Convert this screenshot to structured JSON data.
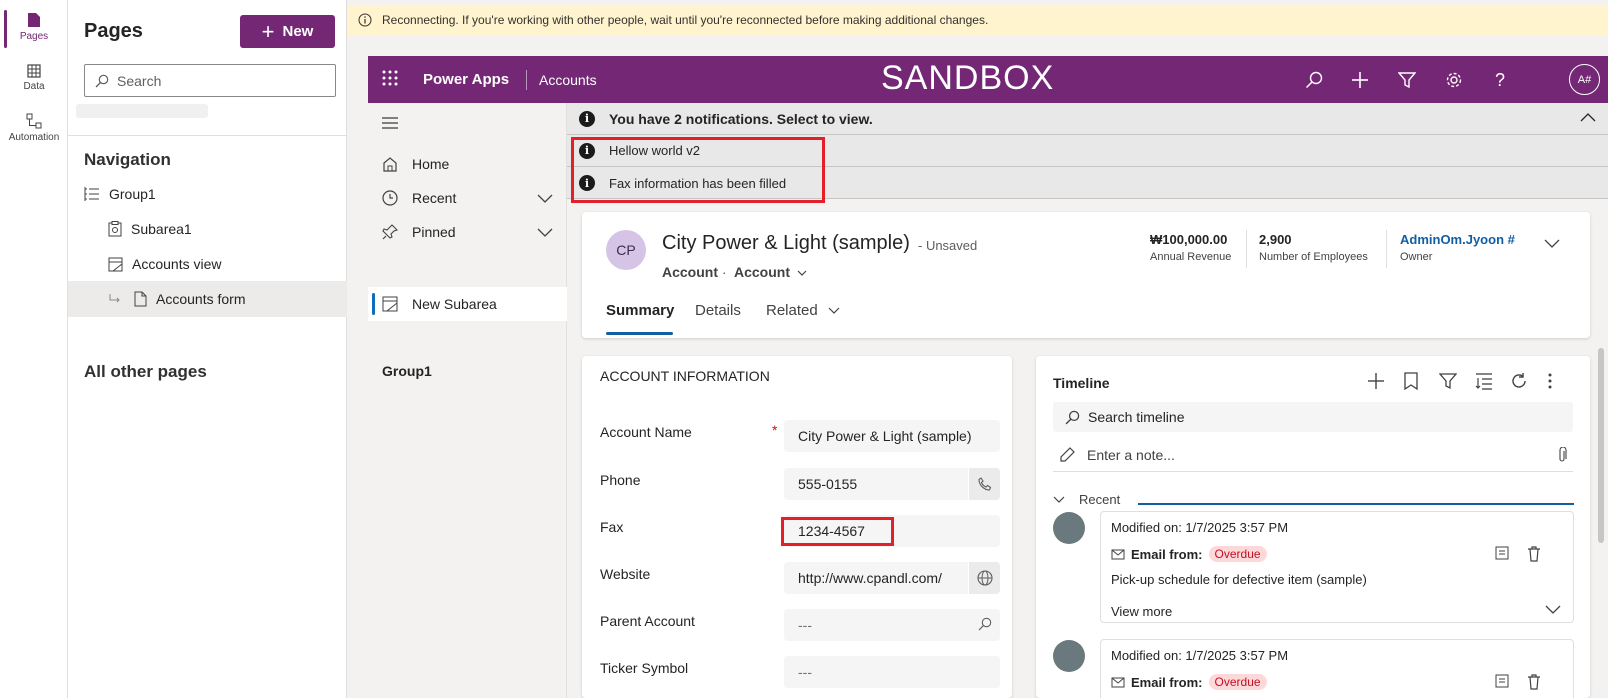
{
  "rail": {
    "items": [
      {
        "label": "Pages",
        "icon": "page-icon"
      },
      {
        "label": "Data",
        "icon": "table-icon"
      },
      {
        "label": "Automation",
        "icon": "flow-icon"
      }
    ]
  },
  "pages_panel": {
    "title": "Pages",
    "new_label": "New",
    "search_placeholder": "Search",
    "navigation_heading": "Navigation",
    "tree": [
      {
        "label": "Group1",
        "icon": "list-icon"
      },
      {
        "label": "Subarea1",
        "icon": "dashboard-icon"
      },
      {
        "label": "Accounts view",
        "icon": "view-icon"
      },
      {
        "label": "Accounts form",
        "icon": "form-icon"
      }
    ],
    "other_pages_heading": "All other pages"
  },
  "reconnect": {
    "message": "Reconnecting. If you're working with other people, wait until you're reconnected before making additional changes."
  },
  "app_header": {
    "app_name": "Power Apps",
    "area": "Accounts",
    "environment": "SANDBOX",
    "avatar": "A#"
  },
  "sitemap": {
    "items": [
      {
        "label": "Home"
      },
      {
        "label": "Recent"
      },
      {
        "label": "Pinned"
      }
    ],
    "group": "Group1",
    "selected": "New Subarea"
  },
  "notifications": {
    "summary": "You have 2 notifications. Select to view.",
    "items": [
      "Hellow world v2",
      "Fax information has been filled"
    ]
  },
  "record": {
    "initials": "CP",
    "title": "City Power & Light (sample)",
    "status": "- Unsaved",
    "entity": "Account",
    "separator": "·",
    "form": "Account",
    "header_fields": [
      {
        "value": "₩100,000.00",
        "label": "Annual Revenue"
      },
      {
        "value": "2,900",
        "label": "Number of Employees"
      },
      {
        "value": "AdminOm.Jyoon #",
        "label": "Owner"
      }
    ],
    "tabs": [
      "Summary",
      "Details",
      "Related"
    ]
  },
  "account_info": {
    "section_title": "ACCOUNT INFORMATION",
    "fields": [
      {
        "label": "Account Name",
        "value": "City Power & Light (sample)",
        "required": "*"
      },
      {
        "label": "Phone",
        "value": "555-0155"
      },
      {
        "label": "Fax",
        "value": "1234-4567"
      },
      {
        "label": "Website",
        "value": "http://www.cpandl.com/"
      },
      {
        "label": "Parent Account",
        "value": "---"
      },
      {
        "label": "Ticker Symbol",
        "value": "---"
      }
    ]
  },
  "timeline": {
    "title": "Timeline",
    "search_placeholder": "Search timeline",
    "note_placeholder": "Enter a note...",
    "recent_label": "Recent",
    "items": [
      {
        "modified": "Modified on: 1/7/2025 3:57 PM",
        "type": "Email from:",
        "badge": "Overdue",
        "description": "Pick-up schedule for defective item (sample)",
        "more": "View more"
      },
      {
        "modified": "Modified on: 1/7/2025 3:57 PM",
        "type": "Email from:",
        "badge": "Overdue"
      }
    ]
  },
  "colors": {
    "brand": "#742774",
    "warning_bg": "#fff4ce",
    "highlight_box": "#e3202a",
    "link": "#115ea3"
  }
}
